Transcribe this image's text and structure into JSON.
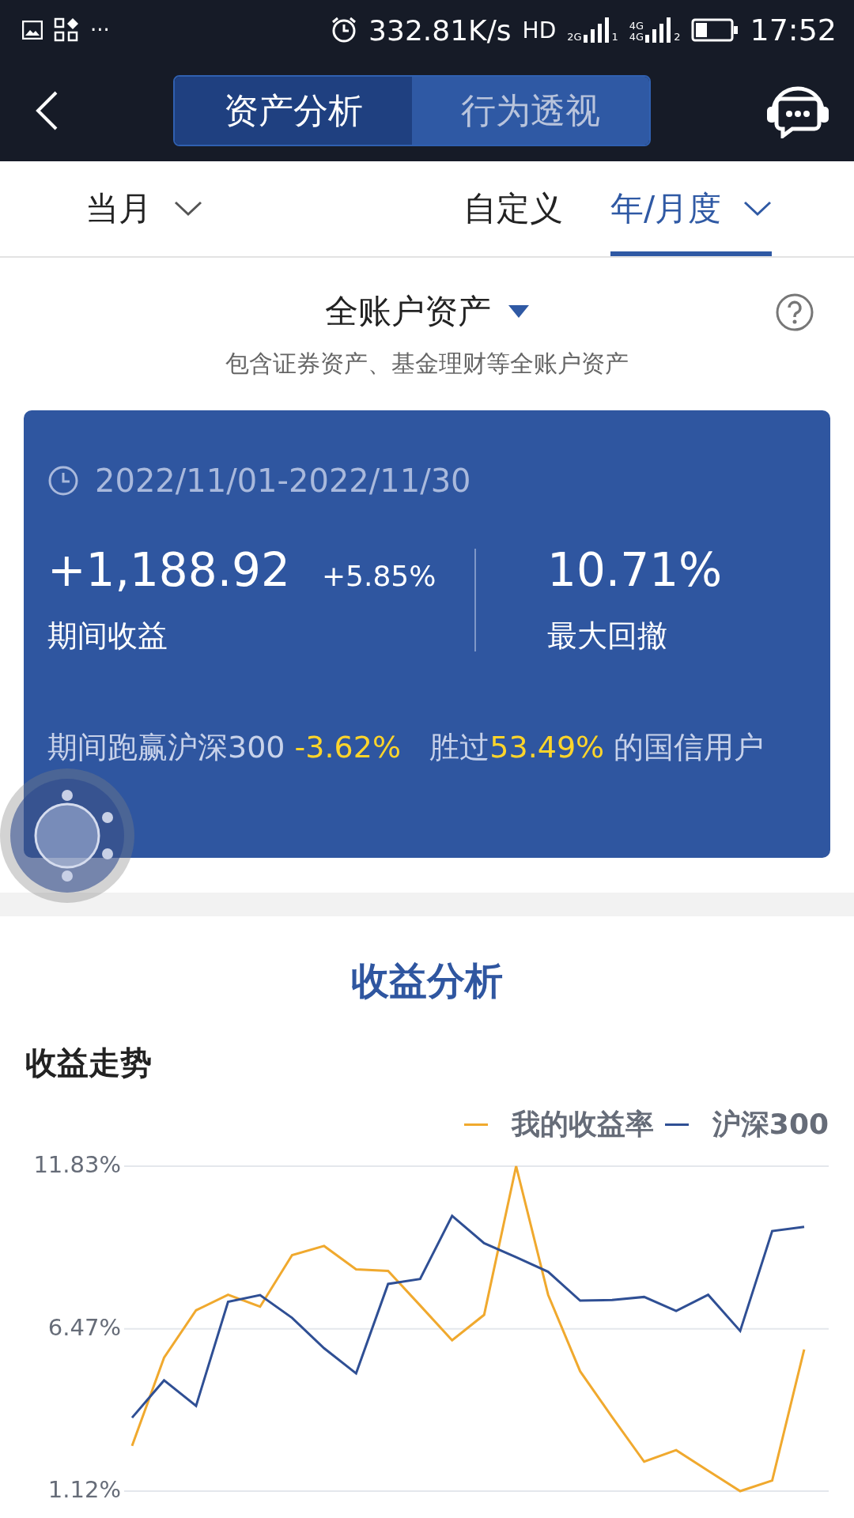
{
  "status_bar": {
    "more": "···",
    "speed": "332.81K/s",
    "hd": "HD",
    "signals": [
      {
        "labels": [
          "2G"
        ],
        "slot": "1"
      },
      {
        "labels": [
          "4G",
          "4G"
        ],
        "slot": "2"
      }
    ],
    "time": "17:52"
  },
  "nav": {
    "tabs": [
      {
        "label": "资产分析",
        "selected": true
      },
      {
        "label": "行为透视",
        "selected": false
      }
    ]
  },
  "period_tabs": [
    {
      "label": "当月",
      "selected": false,
      "dropdown": true
    },
    {
      "label": "自定义",
      "selected": false,
      "dropdown": false
    },
    {
      "label": "年/月度",
      "selected": true,
      "dropdown": true
    }
  ],
  "account": {
    "title": "全账户资产",
    "subtitle": "包含证券资产、基金理财等全账户资产"
  },
  "card": {
    "date_range": "2022/11/01-2022/11/30",
    "profit": "+1,188.92",
    "profit_rate": "+5.85%",
    "profit_label": "期间收益",
    "drawdown": "10.71%",
    "drawdown_label": "最大回撤",
    "summary": [
      {
        "text": "期间跑赢沪深300 ",
        "highlight": false
      },
      {
        "text": "-3.62%",
        "highlight": true
      },
      {
        "text": "   胜过",
        "highlight": false
      },
      {
        "text": "53.49%",
        "highlight": true
      },
      {
        "text": " 的国信用户",
        "highlight": false
      }
    ]
  },
  "section_title": "收益分析",
  "trend": {
    "title": "收益走势",
    "chart_data": {
      "type": "line",
      "categories": [
        null,
        null,
        null,
        null,
        null,
        null,
        null,
        null,
        null,
        null,
        null,
        null,
        null,
        null,
        null,
        null,
        null,
        null,
        null,
        null,
        null,
        null
      ],
      "ylim": [
        1.12,
        11.83
      ],
      "grid": true,
      "yticks": [
        {
          "value": 11.83,
          "label": "11.83%"
        },
        {
          "value": 6.47,
          "label": "6.47%"
        },
        {
          "value": 1.12,
          "label": "1.12%"
        }
      ],
      "series": [
        {
          "name": "我的收益率",
          "color": "#f0a92e",
          "values": [
            2.61,
            5.52,
            7.08,
            7.59,
            7.2,
            8.9,
            9.2,
            8.43,
            8.38,
            7.24,
            6.09,
            6.93,
            11.83,
            7.59,
            5.07,
            3.56,
            2.09,
            2.47,
            1.79,
            1.12,
            1.47,
            5.79
          ]
        },
        {
          "name": "沪深300",
          "color": "#2f4f94",
          "values": [
            3.54,
            4.77,
            3.93,
            7.36,
            7.58,
            6.83,
            5.83,
            5.0,
            7.95,
            8.11,
            10.19,
            9.29,
            8.83,
            8.35,
            7.4,
            7.42,
            7.52,
            7.06,
            7.59,
            6.4,
            9.69,
            9.83
          ]
        }
      ]
    }
  }
}
